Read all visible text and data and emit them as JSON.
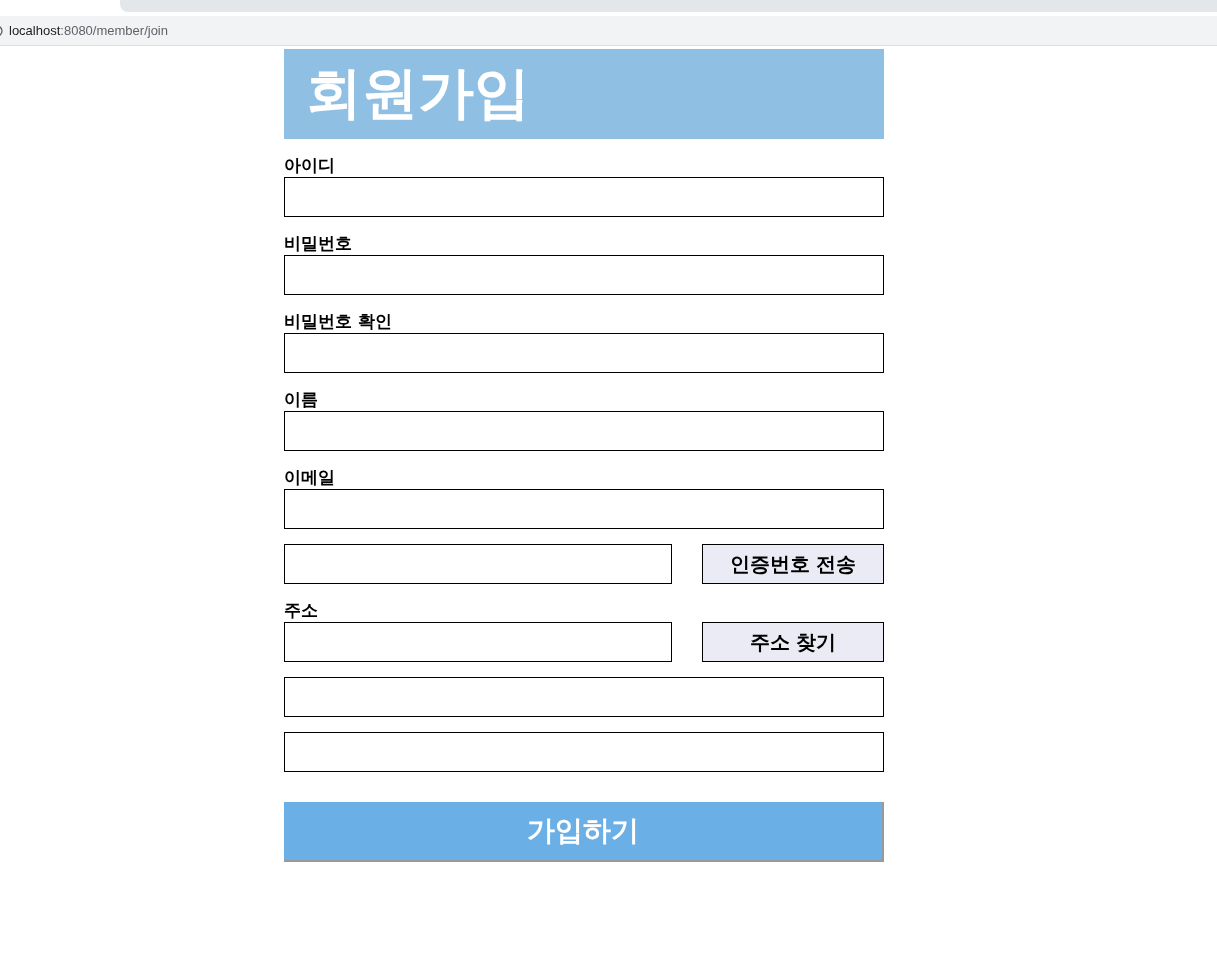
{
  "browser": {
    "url_host": "localhost",
    "url_path": ":8080/member/join"
  },
  "title": "회원가입",
  "rows": [
    {
      "kind": "field",
      "label": "아이디"
    },
    {
      "kind": "field",
      "label": "비밀번호"
    },
    {
      "kind": "field",
      "label": "비밀번호 확인"
    },
    {
      "kind": "field",
      "label": "이름"
    },
    {
      "kind": "field",
      "label": "이메일"
    },
    {
      "kind": "field_button",
      "button": "인증번호 전송"
    },
    {
      "kind": "field_button",
      "label": "주소",
      "button": "주소 찾기"
    },
    {
      "kind": "field"
    },
    {
      "kind": "field"
    }
  ],
  "submit": "가입하기"
}
